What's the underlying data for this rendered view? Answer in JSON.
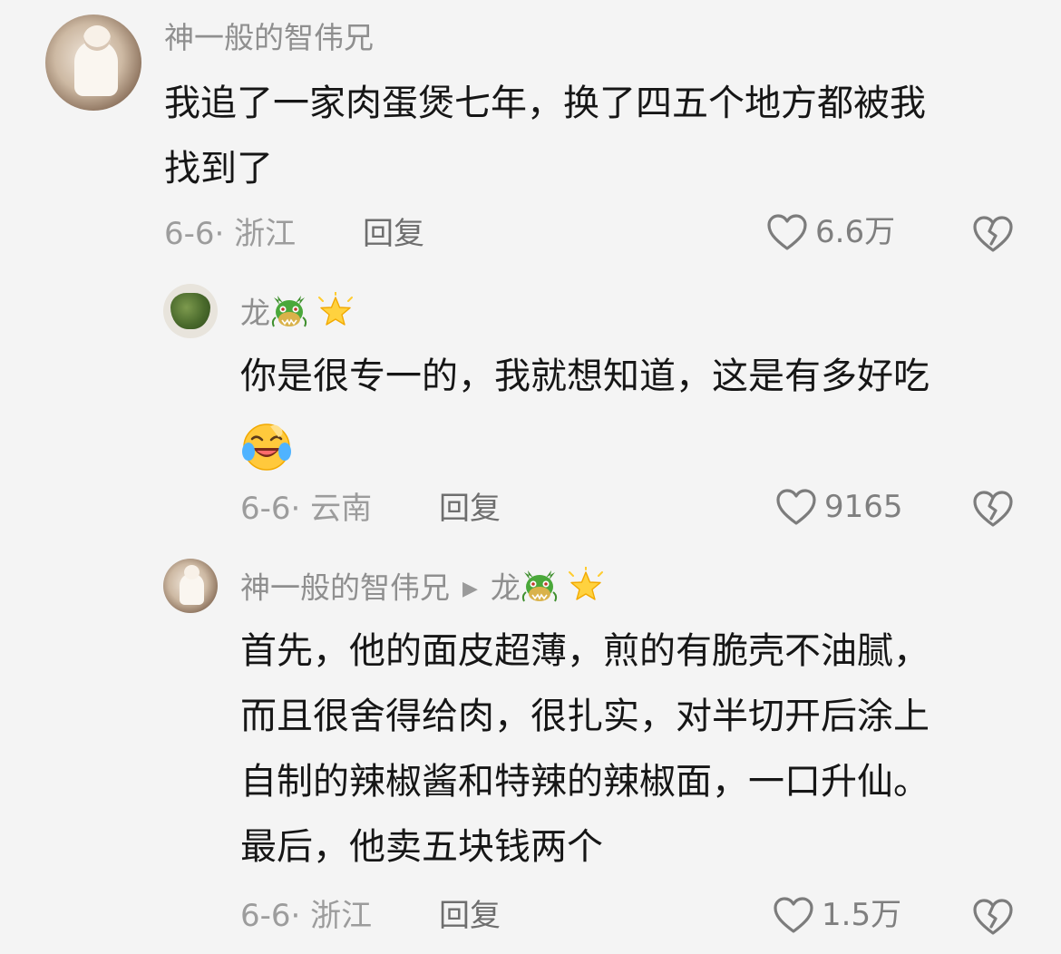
{
  "comments": [
    {
      "username": "神一般的智伟兄",
      "lines": [
        "我追了一家肉蛋煲七年，换了四五个地方都被我",
        "找到了"
      ],
      "date_location": "6-6· 浙江",
      "reply_label": "回复",
      "likes": "6.6万"
    },
    {
      "username": "龙",
      "lines": [
        "你是很专一的，我就想知道，这是有多好吃"
      ],
      "date_location": "6-6· 云南",
      "reply_label": "回复",
      "likes": "9165"
    },
    {
      "username": "神一般的智伟兄",
      "reply_to": "龙",
      "lines": [
        "首先，他的面皮超薄，煎的有脆壳不油腻，",
        "而且很舍得给肉，很扎实，对半切开后涂上",
        "自制的辣椒酱和特辣的辣椒面，一口升仙。",
        "最后，他卖五块钱两个"
      ],
      "date_location": "6-6· 浙江",
      "reply_label": "回复",
      "likes": "1.5万"
    }
  ],
  "icons": {
    "like": "heart-outline-icon",
    "dislike": "broken-heart-icon",
    "reply_arrow": "play-arrow-icon",
    "username_badges": [
      "dragon-emoji-icon",
      "glowing-star-emoji-icon"
    ],
    "reaction_emoji": "laughing-crying-emoji-icon"
  },
  "colors": {
    "background": "#f4f4f4",
    "username": "#8f8f8f",
    "text": "#161616",
    "meta": "#9c9c9c"
  }
}
